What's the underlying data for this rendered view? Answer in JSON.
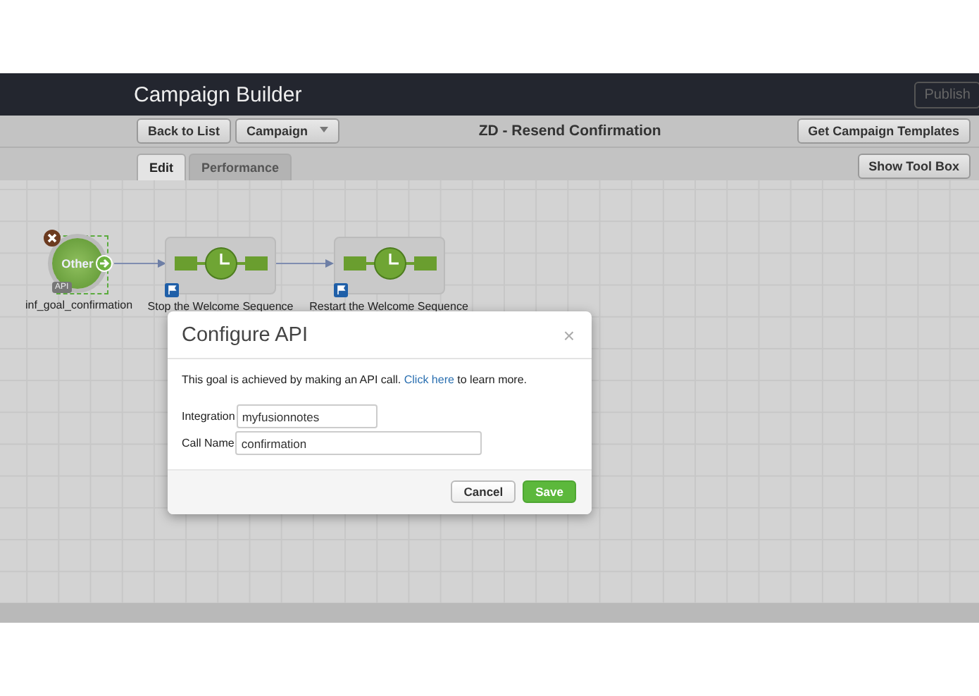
{
  "header": {
    "title": "Campaign Builder",
    "publish": {
      "label": "Publish",
      "disabled": true
    }
  },
  "toolbar": {
    "back_button": "Back to List",
    "campaign_menu": "Campaign",
    "campaign_title": "ZD - Resend Confirmation",
    "templates_button": "Get Campaign Templates"
  },
  "tabs": [
    {
      "label": "Edit",
      "selected": true
    },
    {
      "label": "Performance",
      "selected": false
    }
  ],
  "toolbox_button": "Show Tool Box",
  "canvas": {
    "nodes": [
      {
        "kind": "goal",
        "badge": "Other",
        "tag": "API",
        "label": "inf_goal_confirmation",
        "selected": true
      },
      {
        "kind": "sequence",
        "label": "Stop the Welcome Sequence"
      },
      {
        "kind": "sequence",
        "label": "Restart the Welcome Sequence"
      }
    ]
  },
  "dialog": {
    "title": "Configure API",
    "close": "×",
    "intro_before": "This goal is achieved by making an API call. ",
    "link": "Click here",
    "intro_after": " to learn more.",
    "fields": [
      {
        "label": "Integration",
        "value": "myfusionnotes"
      },
      {
        "label": "Call Name",
        "value": "confirmation"
      }
    ],
    "buttons": [
      {
        "label": "Cancel",
        "kind": "secondary"
      },
      {
        "label": "Save",
        "kind": "primary"
      }
    ]
  }
}
